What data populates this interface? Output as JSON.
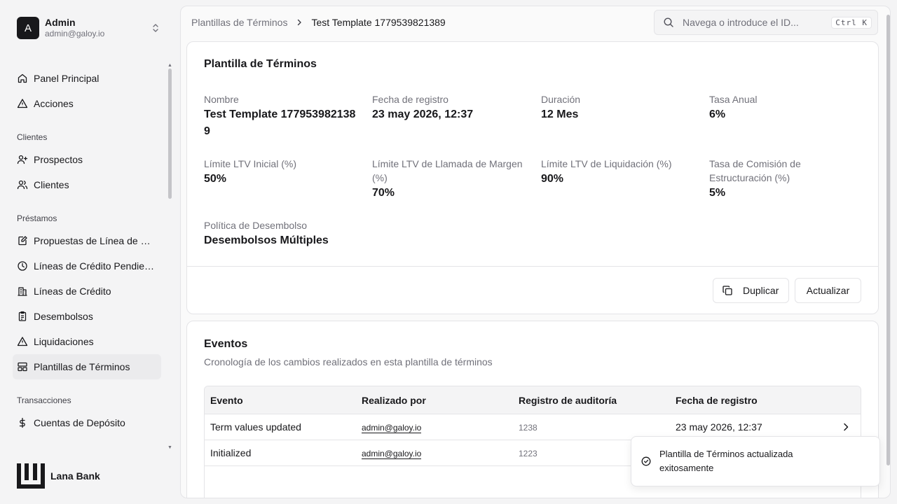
{
  "user": {
    "initial": "A",
    "name": "Admin",
    "email": "admin@galoy.io"
  },
  "nav": {
    "main": [
      {
        "label": "Panel Principal",
        "icon": "home-icon"
      },
      {
        "label": "Acciones",
        "icon": "alert-triangle-icon"
      }
    ],
    "clientes": {
      "heading": "Clientes",
      "items": [
        {
          "label": "Prospectos",
          "icon": "user-plus-icon"
        },
        {
          "label": "Clientes",
          "icon": "users-icon"
        }
      ]
    },
    "prestamos": {
      "heading": "Préstamos",
      "items": [
        {
          "label": "Propuestas de Línea de Cr...",
          "icon": "file-edit-icon"
        },
        {
          "label": "Líneas de Crédito Pendient...",
          "icon": "clock-icon"
        },
        {
          "label": "Líneas de Crédito",
          "icon": "building-icon"
        },
        {
          "label": "Desembolsos",
          "icon": "clipboard-icon"
        },
        {
          "label": "Liquidaciones",
          "icon": "alert-triangle-icon"
        },
        {
          "label": "Plantillas de Términos",
          "icon": "template-icon"
        }
      ]
    },
    "transacciones": {
      "heading": "Transacciones",
      "items": [
        {
          "label": "Cuentas de Depósito",
          "icon": "dollar-icon"
        }
      ]
    }
  },
  "brand": {
    "name": "Lana Bank"
  },
  "breadcrumb": {
    "parent": "Plantillas de Términos",
    "current": "Test Template 1779539821389"
  },
  "search": {
    "placeholder": "Navega o introduce el ID...",
    "shortcut": "Ctrl K"
  },
  "template": {
    "title": "Plantilla de Términos",
    "fields": {
      "nombre": {
        "label": "Nombre",
        "value": "Test Template 1779539821389"
      },
      "fecha": {
        "label": "Fecha de registro",
        "value": "23 may 2026, 12:37"
      },
      "duracion": {
        "label": "Duración",
        "value": "12 Mes"
      },
      "tasa": {
        "label": "Tasa Anual",
        "value": "6%"
      },
      "ltv_inicial": {
        "label": "Límite LTV Inicial (%)",
        "value": "50%"
      },
      "ltv_margen": {
        "label": "Límite LTV de Llamada de Margen (%)",
        "value": "70%"
      },
      "ltv_liquidacion": {
        "label": "Límite LTV de Liquidación (%)",
        "value": "90%"
      },
      "comision": {
        "label": "Tasa de Comisión de Estructuración (%)",
        "value": "5%"
      },
      "politica": {
        "label": "Política de Desembolso",
        "value": "Desembolsos Múltiples"
      }
    },
    "duplicate_label": "Duplicar",
    "update_label": "Actualizar"
  },
  "events": {
    "title": "Eventos",
    "description": "Cronología de los cambios realizados en esta plantilla de términos",
    "columns": [
      "Evento",
      "Realizado por",
      "Registro de auditoría",
      "Fecha de registro"
    ],
    "rows": [
      {
        "event": "Term values updated",
        "by": "admin@galoy.io",
        "audit": "1238",
        "date": "23 may 2026, 12:37"
      },
      {
        "event": "Initialized",
        "by": "admin@galoy.io",
        "audit": "1223",
        "date": ""
      }
    ]
  },
  "toast": {
    "message": "Plantilla de Términos actualizada exitosamente"
  }
}
